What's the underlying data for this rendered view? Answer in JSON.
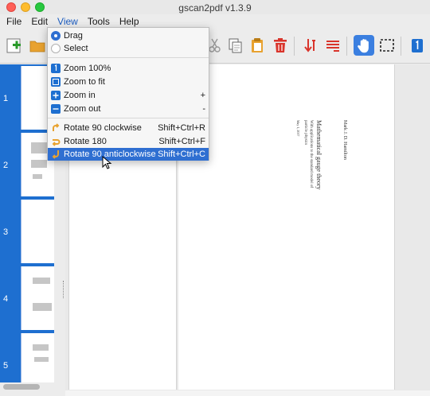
{
  "window": {
    "title": "gscan2pdf v1.3.9"
  },
  "menubar": [
    "File",
    "Edit",
    "View",
    "Tools",
    "Help"
  ],
  "active_menu": "View",
  "view_menu": {
    "drag": "Drag",
    "select": "Select",
    "zoom_100": "Zoom 100%",
    "zoom_fit": "Zoom to fit",
    "zoom_in": "Zoom in",
    "zoom_in_shortcut": "+",
    "zoom_out": "Zoom out",
    "zoom_out_shortcut": "-",
    "rotate_cw": "Rotate 90 clockwise",
    "rotate_cw_shortcut": "Shift+Ctrl+R",
    "rotate_180": "Rotate 180",
    "rotate_180_shortcut": "Shift+Ctrl+F",
    "rotate_ccw": "Rotate 90 anticlockwise",
    "rotate_ccw_shortcut": "Shift+Ctrl+C",
    "selected_mode": "Drag",
    "highlighted": "Rotate 90 anticlockwise"
  },
  "toolbar_icons": [
    "new-scan-icon",
    "open-folder-icon",
    "cut-icon",
    "copy-icon",
    "paste-icon",
    "delete-icon",
    "sort-icon",
    "renumber-icon",
    "hand-drag-icon",
    "select-rect-icon",
    "single-page-icon"
  ],
  "thumbnails": [
    {
      "number": "1"
    },
    {
      "number": "2"
    },
    {
      "number": "3"
    },
    {
      "number": "4"
    },
    {
      "number": "5"
    }
  ],
  "document": {
    "author": "Mark J. D. Hamilton",
    "title": "Mathematical gauge theory",
    "subtitle_line1": "With applications to the standard model of",
    "subtitle_line2": "particle physics",
    "date": "May 1, 2017"
  },
  "colors": {
    "accent": "#2f6fd1",
    "sidebar": "#1e6fd0",
    "delete": "#d9342b",
    "folder": "#e8a230"
  }
}
